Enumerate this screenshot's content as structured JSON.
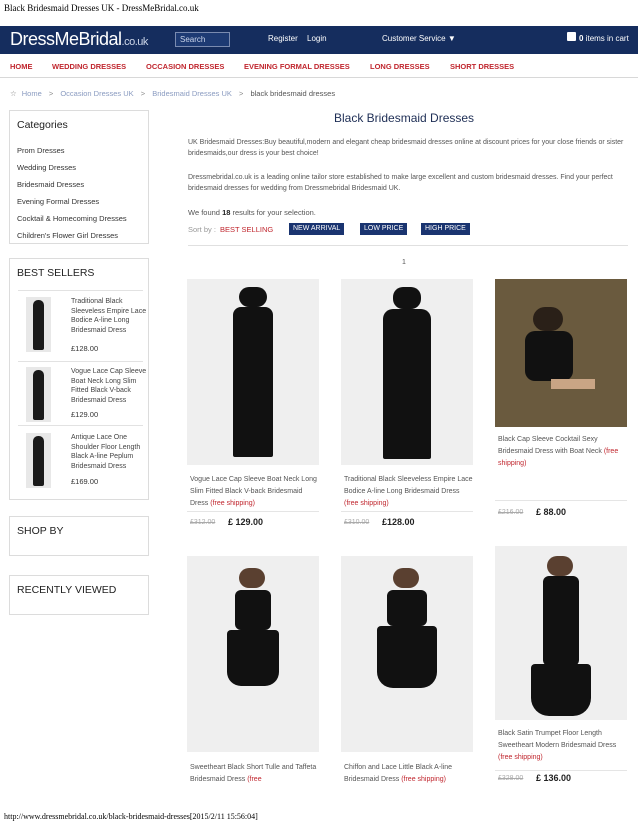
{
  "window": {
    "title": "Black Bridesmaid Dresses UK - DressMeBridal.co.uk",
    "footer_url": "http://www.dressmebridal.co.uk/black-bridesmaid-dresses[2015/2/11 15:56:04]"
  },
  "header": {
    "logo_main": "DressMeBridal",
    "logo_suffix": ".co.uk",
    "search_placeholder": "Search",
    "register": "Register",
    "login": "Login",
    "customer_service": "Customer Service",
    "cart_count": "0",
    "cart_text": "items in cart"
  },
  "nav": [
    "HOME",
    "WEDDING DRESSES",
    "OCCASION DRESSES",
    "EVENING FORMAL DRESSES",
    "LONG DRESSES",
    "SHORT DRESSES"
  ],
  "breadcrumb": {
    "home": "Home",
    "sep": ">",
    "level1": "Occasion Dresses UK",
    "level2": "Bridesmaid Dresses UK",
    "current": "black bridesmaid dresses"
  },
  "sidebar": {
    "categories_title": "Categories",
    "categories": [
      "Prom Dresses",
      "Wedding Dresses",
      "Bridesmaid Dresses",
      "Evening Formal Dresses",
      "Cocktail & Homecoming Dresses",
      "Children's Flower Girl Dresses"
    ],
    "best_sellers_title": "BEST SELLERS",
    "best_sellers": [
      {
        "name": "Traditional Black Sleeveless Empire Lace Bodice A-line Long Bridesmaid Dress",
        "price": "£128.00"
      },
      {
        "name": "Vogue Lace Cap Sleeve Boat Neck Long Slim Fitted Black V-back Bridesmaid Dress",
        "price": "£129.00"
      },
      {
        "name": "Antique Lace One Shoulder Floor Length Black A-line Peplum Bridesmaid Dress",
        "price": "£169.00"
      }
    ],
    "shop_by_title": "SHOP BY",
    "recently_viewed_title": "RECENTLY VIEWED"
  },
  "main": {
    "title": "Black Bridesmaid Dresses",
    "intro1": "UK Bridesmaid Dresses:Buy beautiful,modern and elegant cheap bridesmaid dresses online at discount prices for your close friends or sister bridesmaids,our dress is your best choice!",
    "intro2": "Dressmebridal.co.uk is a leading online tailor store established to make large excellent and custom bridesmaid dresses. Find your perfect bridesmaid dresses for wedding from Dressmebridal Bridesmaid UK.",
    "found_prefix": "We found",
    "found_count": "18",
    "found_suffix": "results for your selection.",
    "sort_label": "Sort by :",
    "sort_options": [
      "BEST SELLING",
      "NEW ARRIVAL",
      "LOW PRICE",
      "HIGH PRICE"
    ],
    "page": "1",
    "shipping_label": "(free shipping)",
    "products": [
      {
        "name": "Vogue Lace Cap Sleeve Boat Neck Long Slim Fitted Black V-back Bridesmaid Dress",
        "old_price": "£312.00",
        "price": "£ 129.00"
      },
      {
        "name": "Traditional Black Sleeveless Empire Lace Bodice A-line Long Bridesmaid Dress",
        "old_price": "£310.00",
        "price": "£128.00"
      },
      {
        "name": "Black Cap Sleeve Cocktail Sexy Bridesmaid Dress with Boat Neck",
        "old_price": "£216.00",
        "price": "£ 88.00"
      },
      {
        "name": "Sweetheart Black Short Tulle and Taffeta Bridesmaid Dress",
        "shipping_partial": "(free",
        "old_price": "",
        "price": ""
      },
      {
        "name": "Chiffon and Lace Little Black A-line Bridesmaid Dress",
        "old_price": "",
        "price": ""
      },
      {
        "name": "Black Satin Trumpet Floor Length Sweetheart Modern Bridesmaid Dress",
        "old_price": "£328.00",
        "price": "£ 136.00"
      }
    ]
  }
}
